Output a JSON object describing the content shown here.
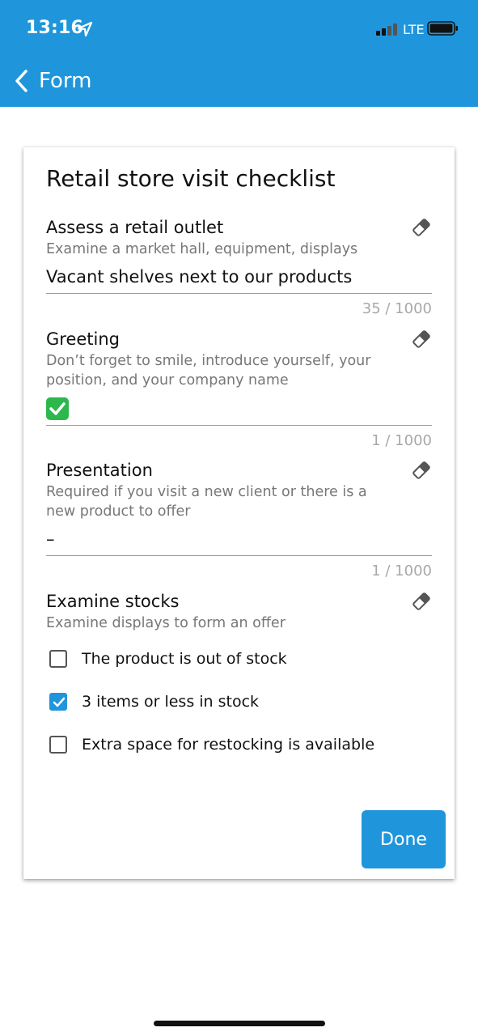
{
  "status_bar": {
    "time": "13:16",
    "network": "LTE"
  },
  "nav": {
    "back_label": "Form"
  },
  "form": {
    "title": "Retail store visit checklist",
    "fields": [
      {
        "label": "Assess a retail outlet",
        "description": "Examine a market hall, equipment, displays",
        "value": "Vacant shelves next to our products",
        "counter": "35 / 1000"
      },
      {
        "label": "Greeting",
        "description": "Don’t forget to smile, introduce yourself, your position, and your company name",
        "value": "✅",
        "counter": "1 / 1000"
      },
      {
        "label": "Presentation",
        "description": "Required if you visit a new client or there is a new product to offer",
        "value": "–",
        "counter": "1 / 1000"
      }
    ],
    "stocks": {
      "label": "Examine stocks",
      "description": "Examine displays to form an offer",
      "options": [
        {
          "label": "The product is out of stock",
          "checked": false
        },
        {
          "label": "3 items or less in stock",
          "checked": true
        },
        {
          "label": "Extra space for restocking is available",
          "checked": false
        }
      ]
    },
    "done_label": "Done"
  },
  "colors": {
    "accent": "#1f96dc",
    "muted": "#777777",
    "counter": "#a8a8a8"
  }
}
